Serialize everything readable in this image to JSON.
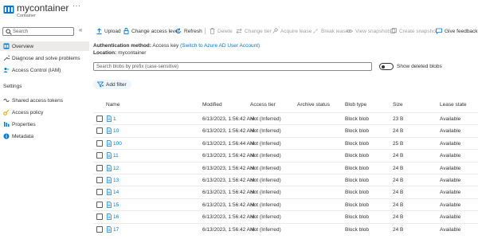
{
  "header": {
    "title": "mycontainer",
    "subtitle": "Container",
    "more": "···"
  },
  "sidebar": {
    "search_placeholder": "Search",
    "collapse": "«",
    "items": [
      {
        "label": "Overview",
        "icon": "overview-icon",
        "active": true
      },
      {
        "label": "Diagnose and solve problems",
        "icon": "wrench-icon"
      },
      {
        "label": "Access Control (IAM)",
        "icon": "people-icon"
      }
    ],
    "settings_label": "Settings",
    "settings_items": [
      {
        "label": "Shared access tokens",
        "icon": "link-icon"
      },
      {
        "label": "Access policy",
        "icon": "key-icon"
      },
      {
        "label": "Properties",
        "icon": "properties-icon"
      },
      {
        "label": "Metadata",
        "icon": "info-icon"
      }
    ]
  },
  "toolbar": {
    "upload": "Upload",
    "change_access_level": "Change access level",
    "refresh": "Refresh",
    "delete": "Delete",
    "change_tier": "Change tier",
    "acquire_lease": "Acquire lease",
    "break_lease": "Break lease",
    "view_snapshots": "View snapshots",
    "create_snapshot": "Create snapshot",
    "give_feedback": "Give feedback"
  },
  "info": {
    "auth_label": "Authentication method:",
    "auth_value": "Access key",
    "auth_link": "(Switch to Azure AD User Account)",
    "location_label": "Location:",
    "location_value": "mycontainer"
  },
  "filter": {
    "search_placeholder": "Search blobs by prefix (case-sensitive)",
    "show_deleted": "Show deleted blobs",
    "add_filter": "Add filter"
  },
  "table": {
    "columns": [
      "Name",
      "Modified",
      "Access tier",
      "Archive status",
      "Blob type",
      "Size",
      "Lease state"
    ],
    "rows": [
      {
        "name": "1",
        "modified": "6/13/2023, 1:56:42 AM",
        "tier": "Hot (Inferred)",
        "archive": "",
        "type": "Block blob",
        "size": "23 B",
        "lease": "Available"
      },
      {
        "name": "10",
        "modified": "6/13/2023, 1:56:42 AM",
        "tier": "Hot (Inferred)",
        "archive": "",
        "type": "Block blob",
        "size": "24 B",
        "lease": "Available"
      },
      {
        "name": "100",
        "modified": "6/13/2023, 1:56:44 AM",
        "tier": "Hot (Inferred)",
        "archive": "",
        "type": "Block blob",
        "size": "25 B",
        "lease": "Available"
      },
      {
        "name": "11",
        "modified": "6/13/2023, 1:56:42 AM",
        "tier": "Hot (Inferred)",
        "archive": "",
        "type": "Block blob",
        "size": "24 B",
        "lease": "Available"
      },
      {
        "name": "12",
        "modified": "6/13/2023, 1:56:42 AM",
        "tier": "Hot (Inferred)",
        "archive": "",
        "type": "Block blob",
        "size": "24 B",
        "lease": "Available"
      },
      {
        "name": "13",
        "modified": "6/13/2023, 1:56:42 AM",
        "tier": "Hot (Inferred)",
        "archive": "",
        "type": "Block blob",
        "size": "24 B",
        "lease": "Available"
      },
      {
        "name": "14",
        "modified": "6/13/2023, 1:56:42 AM",
        "tier": "Hot (Inferred)",
        "archive": "",
        "type": "Block blob",
        "size": "24 B",
        "lease": "Available"
      },
      {
        "name": "15",
        "modified": "6/13/2023, 1:56:42 AM",
        "tier": "Hot (Inferred)",
        "archive": "",
        "type": "Block blob",
        "size": "24 B",
        "lease": "Available"
      },
      {
        "name": "16",
        "modified": "6/13/2023, 1:56:42 AM",
        "tier": "Hot (Inferred)",
        "archive": "",
        "type": "Block blob",
        "size": "24 B",
        "lease": "Available"
      },
      {
        "name": "17",
        "modified": "6/13/2023, 1:56:42 AM",
        "tier": "Hot (Inferred)",
        "archive": "",
        "type": "Block blob",
        "size": "24 B",
        "lease": "Available"
      }
    ]
  },
  "colors": {
    "accent": "#0078d4",
    "text": "#323130",
    "muted": "#605e5c",
    "disabled": "#a19f9d",
    "active_bg": "#edebe9"
  }
}
